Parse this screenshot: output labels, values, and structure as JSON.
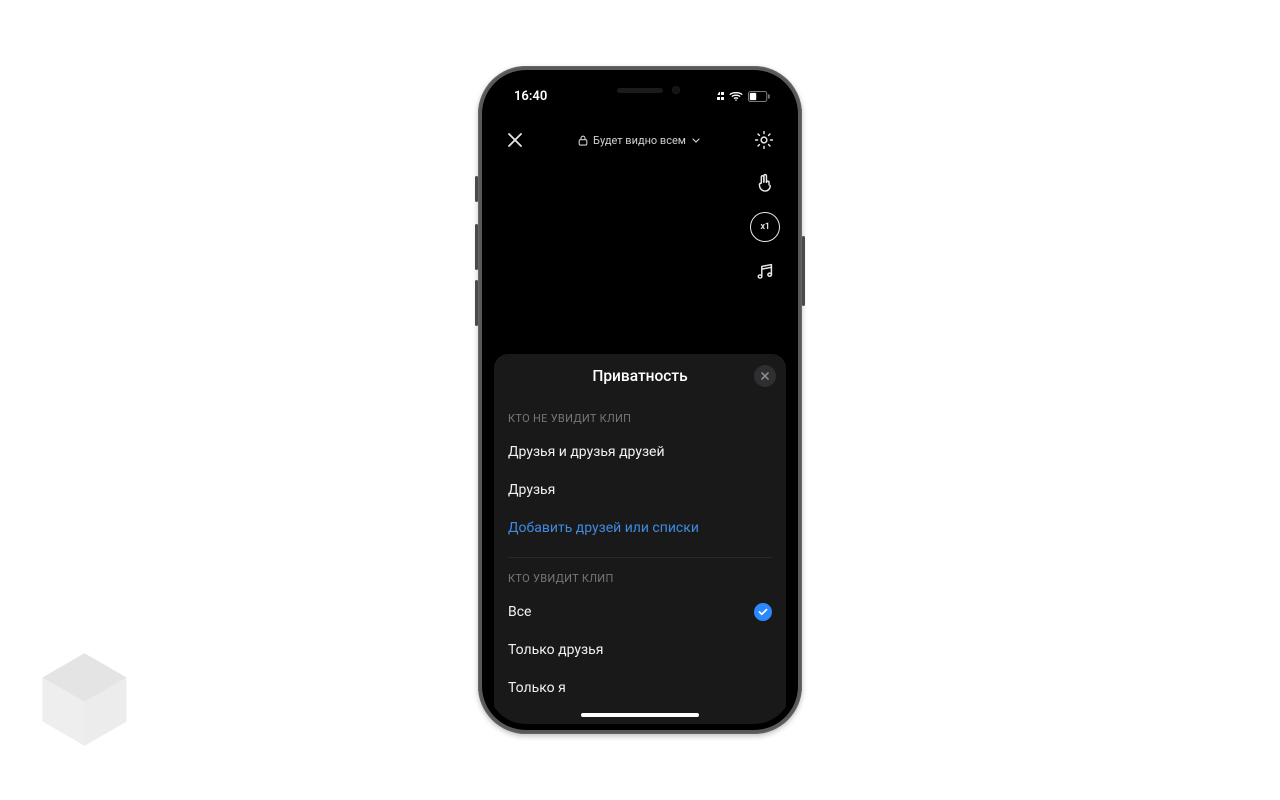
{
  "status": {
    "time": "16:40"
  },
  "header": {
    "visibility_label": "Будет видно всем"
  },
  "tools": {
    "speed": "x1"
  },
  "sheet": {
    "title": "Приватность",
    "section_hide": {
      "header": "КТО НЕ УВИДИТ КЛИП",
      "options": [
        {
          "label": "Друзья и друзья друзей"
        },
        {
          "label": "Друзья"
        }
      ],
      "add_link": "Добавить друзей или списки"
    },
    "section_show": {
      "header": "КТО УВИДИТ КЛИП",
      "options": [
        {
          "label": "Все",
          "selected": true
        },
        {
          "label": "Только друзья",
          "selected": false
        },
        {
          "label": "Только я",
          "selected": false
        }
      ]
    }
  }
}
